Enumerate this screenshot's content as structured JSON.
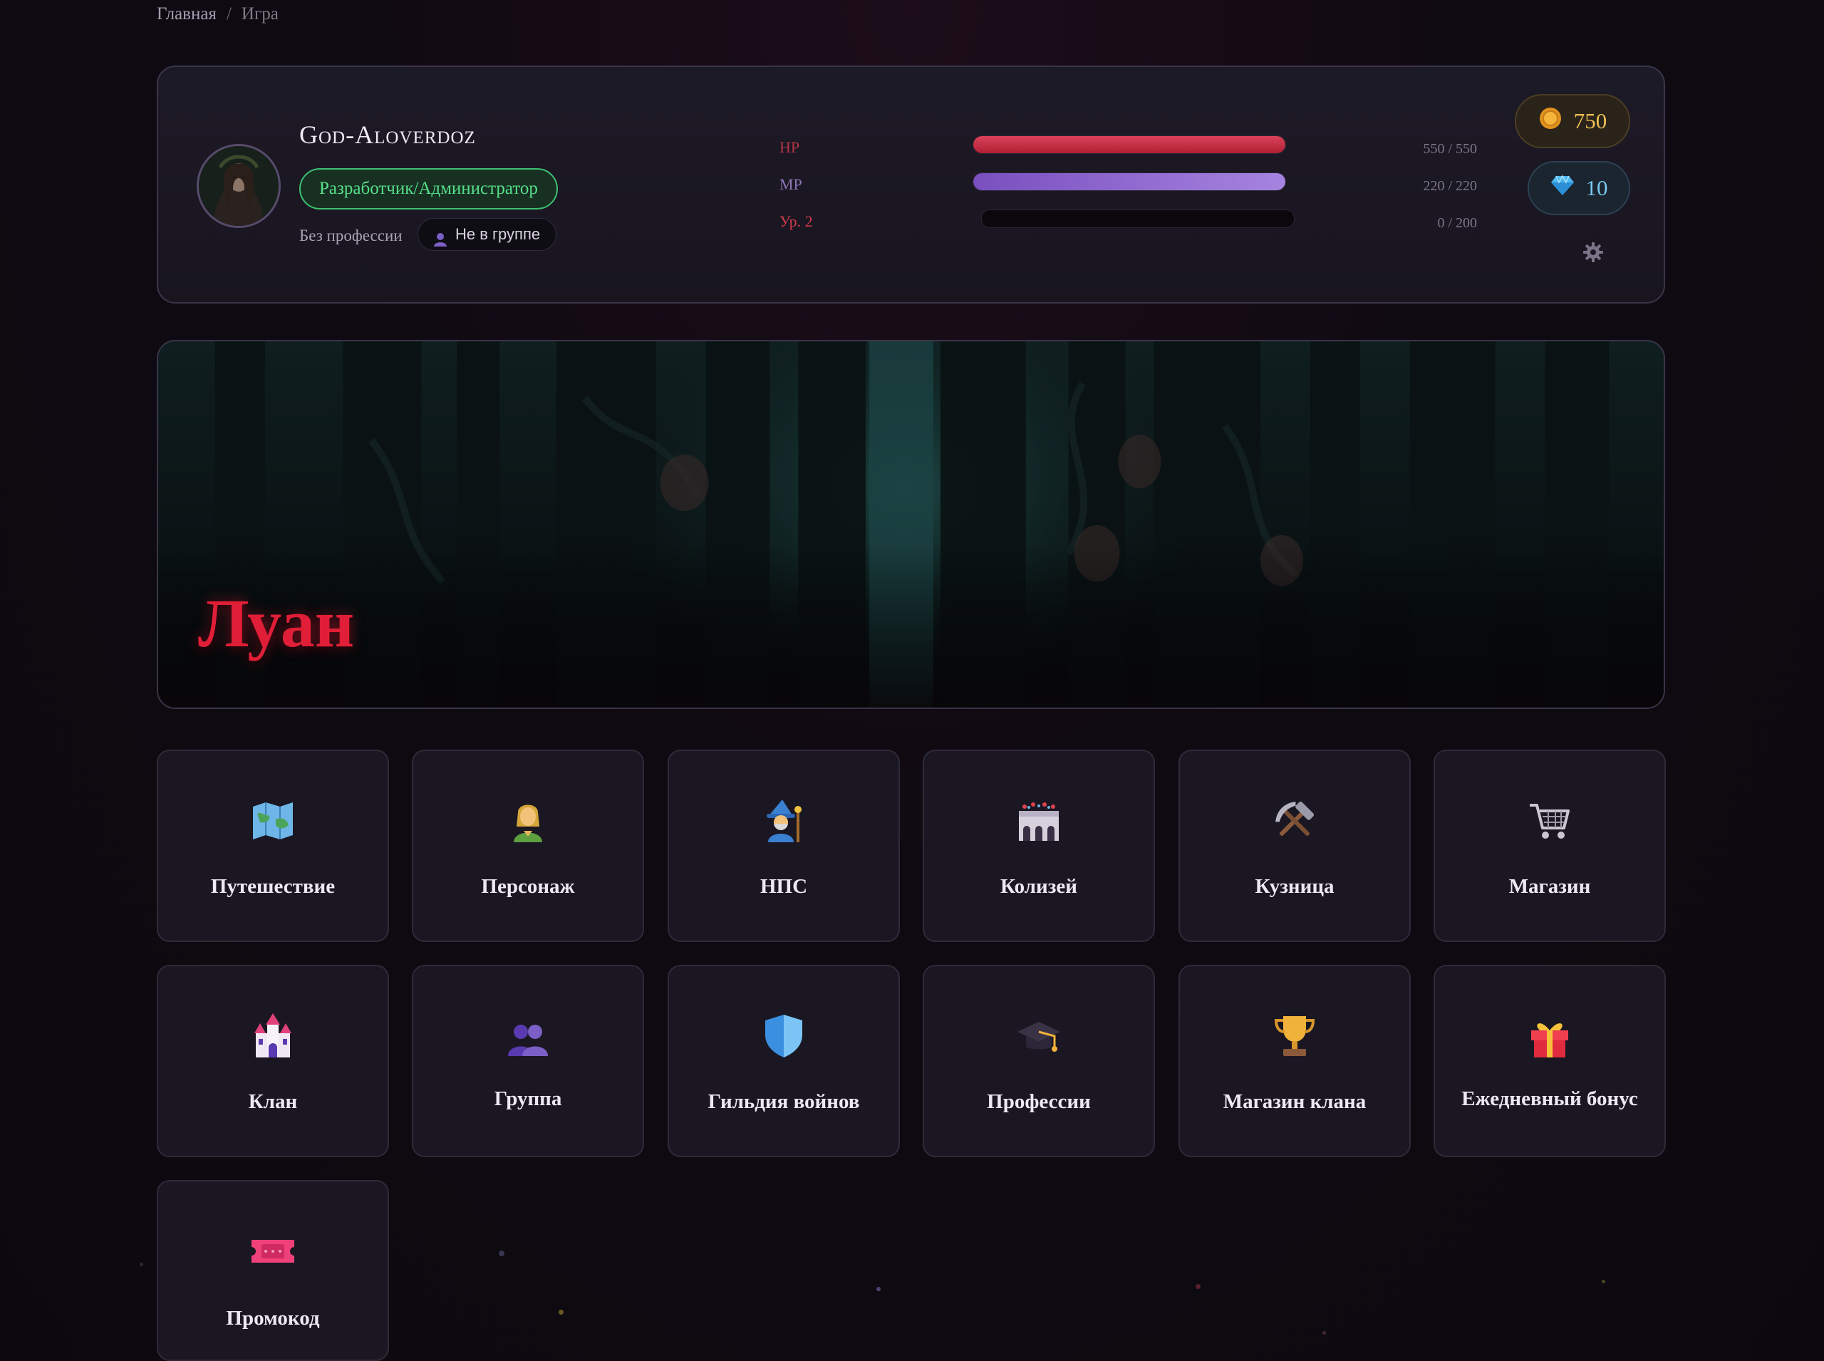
{
  "breadcrumb": {
    "home": "Главная",
    "separator": "/",
    "current": "Игра"
  },
  "player": {
    "name": "God-Aloverdoz",
    "role": "Разработчик/Администратор",
    "profession": "Без профессии",
    "group_status": "Не в группе"
  },
  "stats": {
    "hp": {
      "label": "HP",
      "text": "550 / 550",
      "current": 550,
      "max": 550,
      "color": "#c8283c"
    },
    "mp": {
      "label": "MP",
      "text": "220 / 220",
      "current": 220,
      "max": 220,
      "color": "#8a5cc8"
    },
    "xp": {
      "label": "Ур. 2",
      "text": "0 / 200",
      "current": 0,
      "max": 200,
      "color": "#e0414f"
    }
  },
  "currency": {
    "gold": "750",
    "gems": "10"
  },
  "location": {
    "name": "Луан"
  },
  "menu": [
    {
      "label": "Путешествие",
      "icon": "map-icon"
    },
    {
      "label": "Персонаж",
      "icon": "character-icon"
    },
    {
      "label": "НПС",
      "icon": "wizard-icon"
    },
    {
      "label": "Колизей",
      "icon": "colosseum-icon"
    },
    {
      "label": "Кузница",
      "icon": "hammer-pick-icon"
    },
    {
      "label": "Магазин",
      "icon": "cart-icon"
    },
    {
      "label": "Клан",
      "icon": "castle-icon"
    },
    {
      "label": "Группа",
      "icon": "group-icon"
    },
    {
      "label": "Гильдия войнов",
      "icon": "shield-icon"
    },
    {
      "label": "Профессии",
      "icon": "graduation-cap-icon"
    },
    {
      "label": "Магазин клана",
      "icon": "trophy-icon"
    },
    {
      "label": "Ежедневный бонус",
      "icon": "gift-icon"
    },
    {
      "label": "Промокод",
      "icon": "ticket-icon"
    }
  ]
}
